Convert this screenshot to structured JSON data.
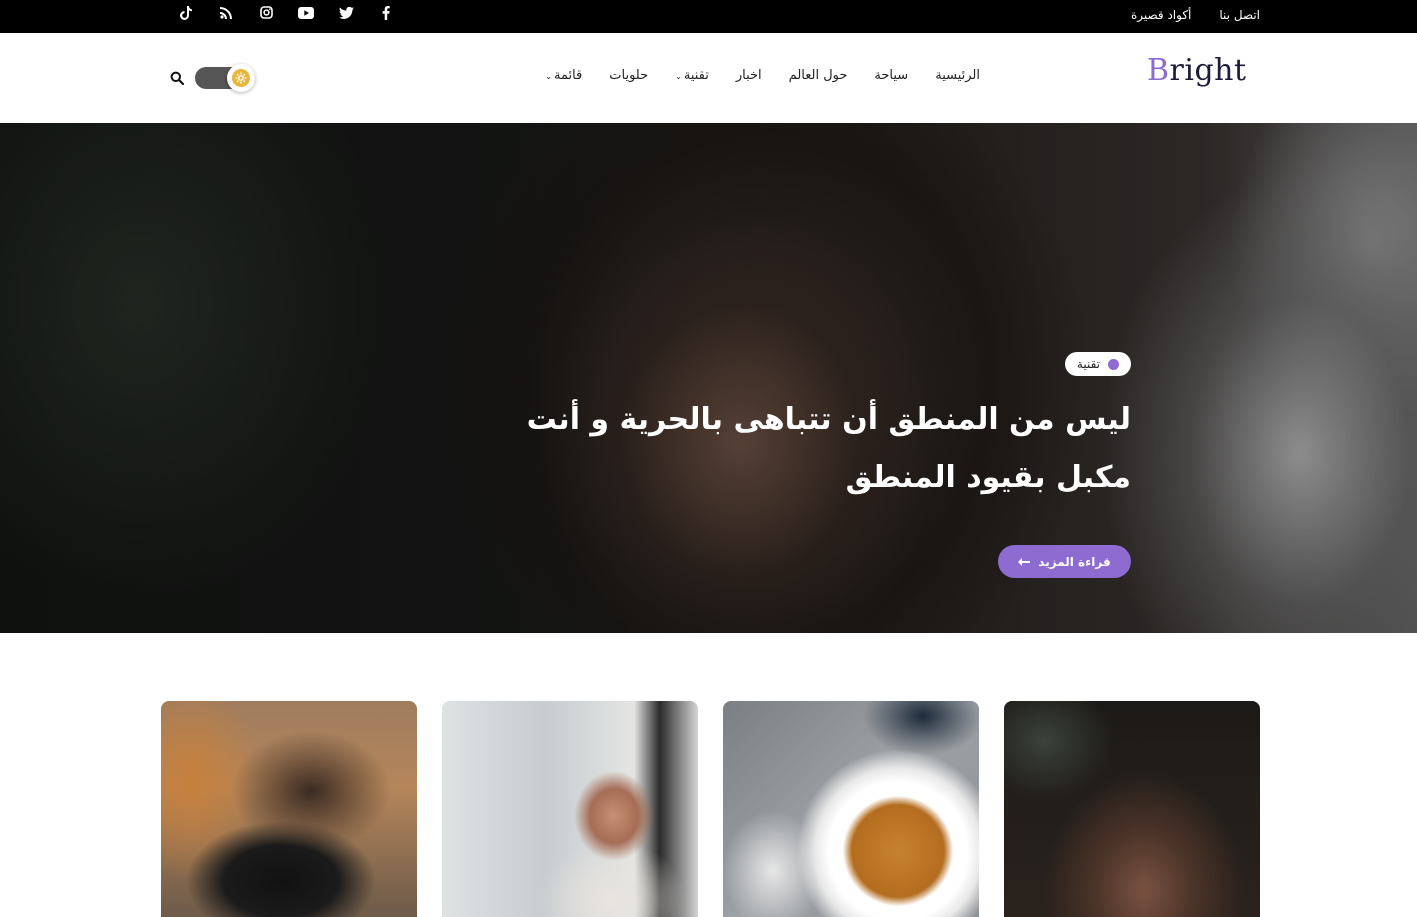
{
  "topbar": {
    "links": [
      "اتصل بنا",
      "أكواد قصيرة"
    ],
    "social_icons": [
      "facebook-icon",
      "twitter-icon",
      "youtube-icon",
      "instagram-icon",
      "rss-icon",
      "tiktok-icon"
    ]
  },
  "header": {
    "logo_first": "B",
    "logo_rest": "right",
    "nav": [
      {
        "label": "الرئيسية",
        "dropdown": false
      },
      {
        "label": "سياحة",
        "dropdown": false
      },
      {
        "label": "حول العالم",
        "dropdown": false
      },
      {
        "label": "اخبار",
        "dropdown": false
      },
      {
        "label": "تقنية",
        "dropdown": true
      },
      {
        "label": "حلويات",
        "dropdown": false
      },
      {
        "label": "قائمة",
        "dropdown": true
      }
    ],
    "accent_color": "#8e6bd1",
    "toggle_icon": "gear-icon"
  },
  "hero": {
    "category": "تقنية",
    "title": "ليس من المنطق أن تتباهى بالحرية و أنت مكبل بقيود المنطق",
    "read_more": "قراءة المزيد"
  },
  "cards": [
    {
      "image": "photographer-camera"
    },
    {
      "image": "smiling-man"
    },
    {
      "image": "coffee-cup"
    },
    {
      "image": "face-portrait"
    }
  ]
}
